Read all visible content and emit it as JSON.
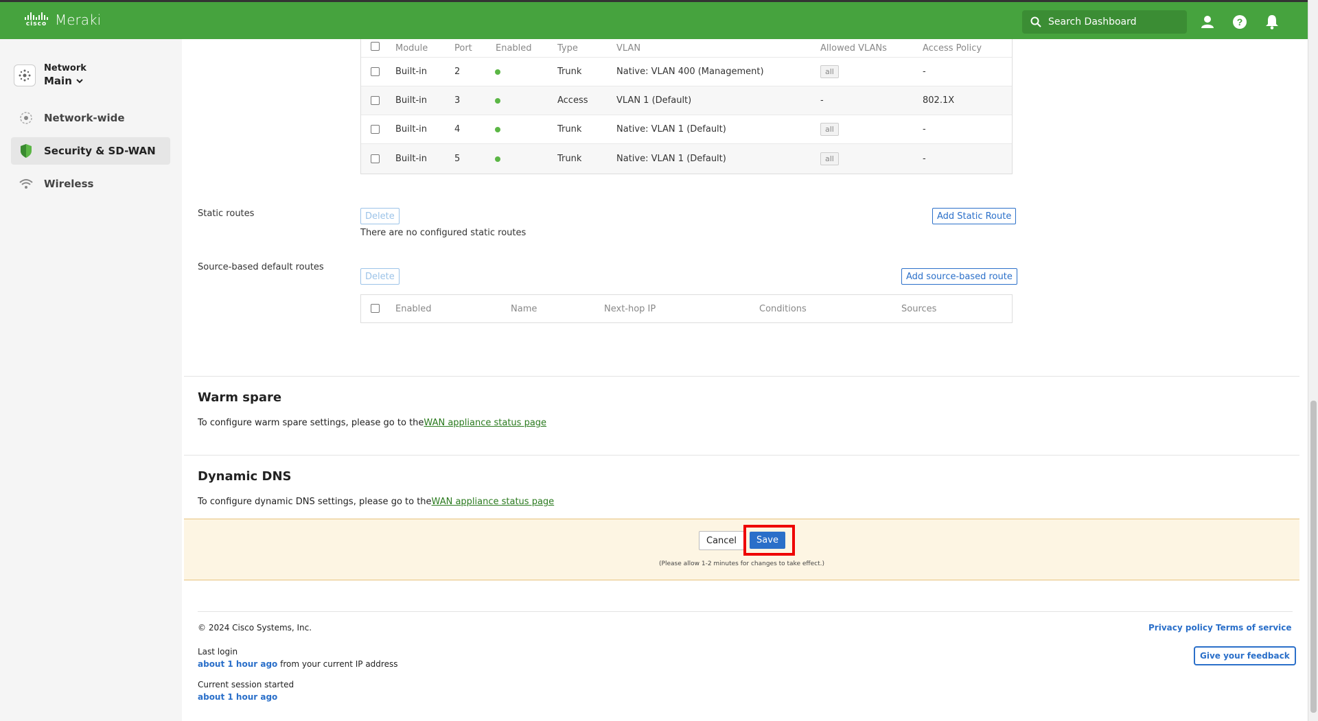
{
  "header": {
    "logo_cisco": "cisco",
    "logo_meraki": "Meraki",
    "search_placeholder": "Search Dashboard",
    "icons": [
      "user-icon",
      "help-icon",
      "bell-icon"
    ]
  },
  "sidebar": {
    "network_label": "Network",
    "network_value": "Main",
    "items": [
      {
        "label": "Network-wide",
        "icon": "network-wide-icon",
        "active": false
      },
      {
        "label": "Security & SD-WAN",
        "icon": "shield-icon",
        "active": true
      },
      {
        "label": "Wireless",
        "icon": "wifi-icon",
        "active": false
      }
    ]
  },
  "ports_table": {
    "headers": [
      "Module",
      "Port",
      "Enabled",
      "Type",
      "VLAN",
      "Allowed VLANs",
      "Access Policy"
    ],
    "rows": [
      {
        "module": "Built-in",
        "port": "2",
        "type": "Trunk",
        "vlan": "Native: VLAN 400 (Management)",
        "allowed": "all",
        "policy": "-"
      },
      {
        "module": "Built-in",
        "port": "3",
        "type": "Access",
        "vlan": "VLAN 1 (Default)",
        "allowed": "-",
        "policy": "802.1X"
      },
      {
        "module": "Built-in",
        "port": "4",
        "type": "Trunk",
        "vlan": "Native: VLAN 1 (Default)",
        "allowed": "all",
        "policy": "-"
      },
      {
        "module": "Built-in",
        "port": "5",
        "type": "Trunk",
        "vlan": "Native: VLAN 1 (Default)",
        "allowed": "all",
        "policy": "-"
      }
    ]
  },
  "static_routes": {
    "label": "Static routes",
    "delete_label": "Delete",
    "add_label": "Add Static Route",
    "empty_text": "There are no configured static routes"
  },
  "source_routes": {
    "label": "Source-based default routes",
    "delete_label": "Delete",
    "add_label": "Add source-based route",
    "headers": [
      "Enabled",
      "Name",
      "Next-hop IP",
      "Conditions",
      "Sources"
    ]
  },
  "warm_spare": {
    "title": "Warm spare",
    "text": "To configure warm spare settings, please go to the",
    "link": "WAN appliance status page"
  },
  "dynamic_dns": {
    "title": "Dynamic DNS",
    "text": "To configure dynamic DNS settings, please go to the",
    "link": "WAN appliance status page"
  },
  "savebar": {
    "cancel_label": "Cancel",
    "save_label": "Save",
    "note": "(Please allow 1-2 minutes for changes to take effect.)"
  },
  "footer": {
    "copyright": "© 2024 Cisco Systems, Inc.",
    "last_login_label": "Last login",
    "last_login_time": "about 1 hour ago",
    "last_login_suffix": " from your current IP address",
    "session_label": "Current session started",
    "session_time": "about 1 hour ago",
    "privacy": "Privacy policy",
    "terms": "Terms of service",
    "feedback": "Give your feedback"
  },
  "colors": {
    "brand_green": "#46a33e",
    "link_blue": "#2a6fc9",
    "enabled_dot": "#5bb645",
    "highlight": "#e00000"
  }
}
